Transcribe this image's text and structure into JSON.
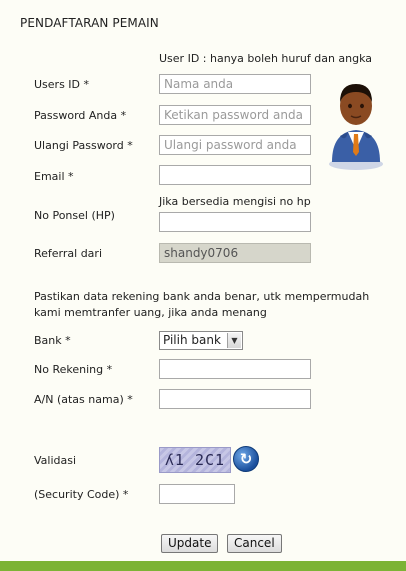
{
  "title": "PENDAFTARAN PEMAIN",
  "hints": {
    "user_id": "User ID : hanya boleh huruf dan angka",
    "phone": "Jika bersedia mengisi no hp"
  },
  "fields": {
    "user_id": {
      "label": "Users ID *",
      "placeholder": "Nama anda"
    },
    "password": {
      "label": "Password Anda *",
      "placeholder": "Ketikan password anda"
    },
    "password_repeat": {
      "label": "Ulangi Password *",
      "placeholder": "Ulangi password anda"
    },
    "email": {
      "label": "Email *",
      "value": ""
    },
    "phone": {
      "label": "No Ponsel (HP)",
      "value": ""
    },
    "referral": {
      "label": "Referral dari",
      "value": "shandy0706"
    },
    "bank": {
      "label": "Bank *",
      "selected": "Pilih bank"
    },
    "account_no": {
      "label": "No Rekening *",
      "value": ""
    },
    "account_name": {
      "label": "A/N (atas nama) *",
      "value": ""
    },
    "validation": {
      "label": "Validasi",
      "captcha_text": "ʎ1 2C1"
    },
    "security_code": {
      "label": "(Security Code) *",
      "value": ""
    }
  },
  "bank_note": "Pastikan data rekening bank anda benar, utk mempermudah kami memtranfer uang, jika anda menang",
  "buttons": {
    "update": "Update",
    "cancel": "Cancel"
  },
  "icons": {
    "avatar": "user-avatar-icon",
    "refresh": "refresh-icon",
    "select_arrow": "chevron-down-icon"
  },
  "colors": {
    "bottom_bar": "#7cb335",
    "readonly_bg": "#d6d6cb",
    "background": "#fdfdf6"
  }
}
